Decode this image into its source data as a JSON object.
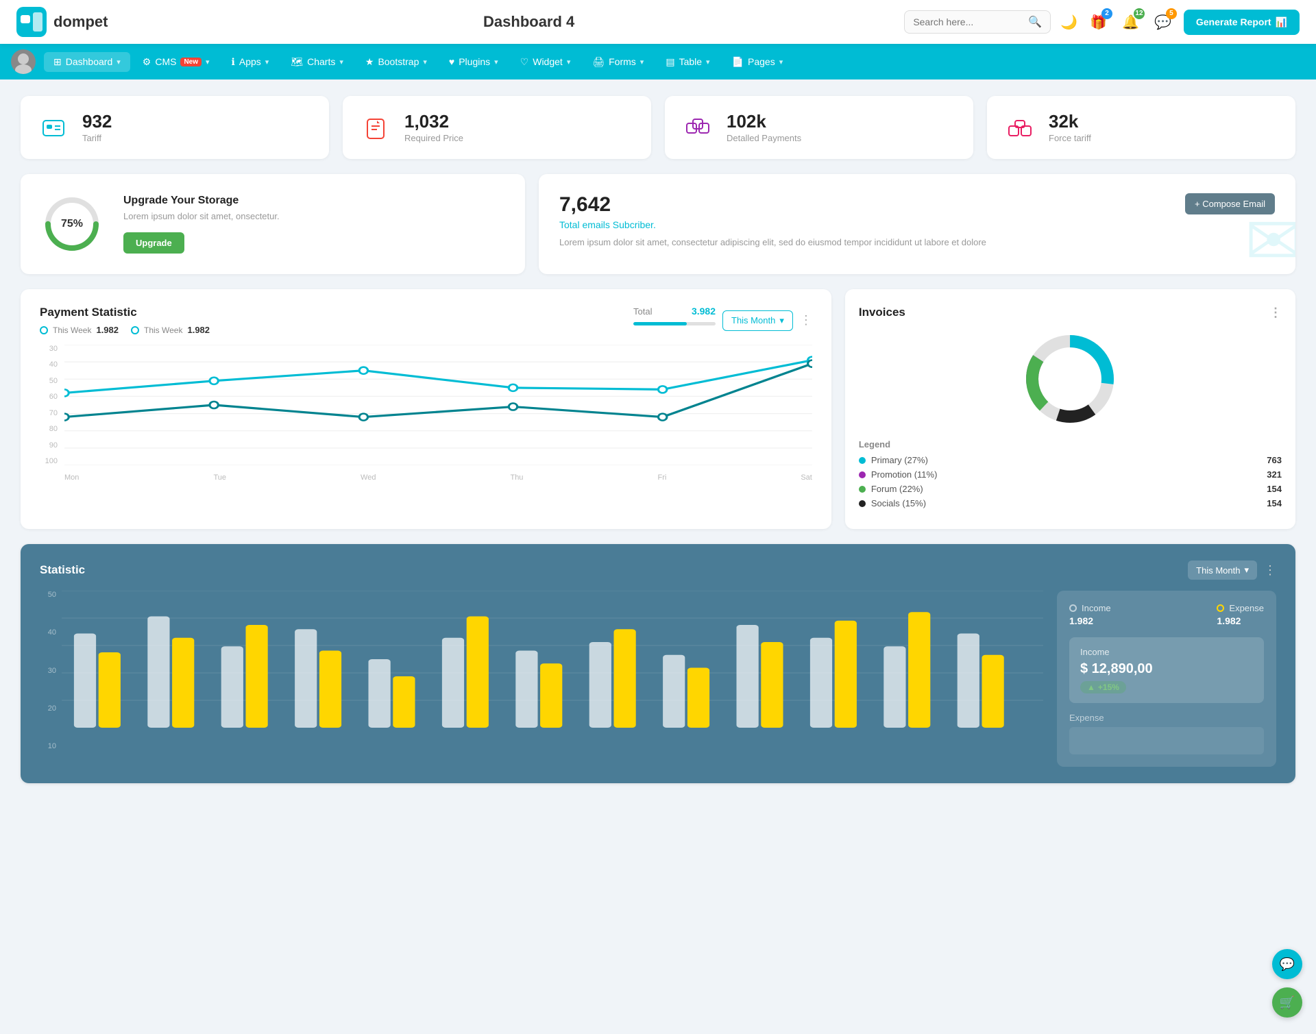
{
  "header": {
    "logo_text": "dompet",
    "page_title": "Dashboard 4",
    "search_placeholder": "Search here...",
    "generate_btn": "Generate Report",
    "badges": {
      "gift": "2",
      "bell": "12",
      "chat": "5"
    }
  },
  "navbar": {
    "items": [
      {
        "label": "Dashboard",
        "active": true,
        "has_chevron": true
      },
      {
        "label": "CMS",
        "active": false,
        "has_new": true,
        "has_chevron": true
      },
      {
        "label": "Apps",
        "active": false,
        "has_chevron": true
      },
      {
        "label": "Charts",
        "active": false,
        "has_chevron": true
      },
      {
        "label": "Bootstrap",
        "active": false,
        "has_chevron": true
      },
      {
        "label": "Plugins",
        "active": false,
        "has_chevron": true
      },
      {
        "label": "Widget",
        "active": false,
        "has_chevron": true
      },
      {
        "label": "Forms",
        "active": false,
        "has_chevron": true
      },
      {
        "label": "Table",
        "active": false,
        "has_chevron": true
      },
      {
        "label": "Pages",
        "active": false,
        "has_chevron": true
      }
    ]
  },
  "stat_cards": [
    {
      "value": "932",
      "label": "Tariff",
      "icon": "tariff"
    },
    {
      "value": "1,032",
      "label": "Required Price",
      "icon": "price"
    },
    {
      "value": "102k",
      "label": "Detalled Payments",
      "icon": "payments"
    },
    {
      "value": "32k",
      "label": "Force tariff",
      "icon": "force"
    }
  ],
  "storage": {
    "percent": "75%",
    "title": "Upgrade Your Storage",
    "desc": "Lorem ipsum dolor sit amet, onsectetur.",
    "btn": "Upgrade",
    "percent_num": 75
  },
  "email": {
    "count": "7,642",
    "subtitle": "Total emails Subcriber.",
    "desc": "Lorem ipsum dolor sit amet, consectetur adipiscing elit, sed do eiusmod tempor incididunt ut labore et dolore",
    "compose_btn": "+ Compose Email"
  },
  "payment_statistic": {
    "title": "Payment Statistic",
    "this_week_1_label": "This Week",
    "this_week_1_value": "1.982",
    "this_week_2_label": "This Week",
    "this_week_2_value": "1.982",
    "this_month_btn": "This Month",
    "total_label": "Total",
    "total_value": "3.982",
    "progress": 65,
    "y_labels": [
      "100",
      "90",
      "80",
      "70",
      "60",
      "50",
      "40",
      "30"
    ],
    "x_labels": [
      "Mon",
      "Tue",
      "Wed",
      "Thu",
      "Fri",
      "Sat"
    ],
    "line1_points": "0,60 140,70 280,80 420,65 560,63 700,90",
    "line2_points": "0,40 140,50 280,40 420,50 560,40 700,87"
  },
  "invoices": {
    "title": "Invoices",
    "legend": [
      {
        "label": "Primary (27%)",
        "color": "#00BCD4",
        "value": "763"
      },
      {
        "label": "Promotion (11%)",
        "color": "#9C27B0",
        "value": "321"
      },
      {
        "label": "Forum (22%)",
        "color": "#4CAF50",
        "value": "154"
      },
      {
        "label": "Socials (15%)",
        "color": "#333",
        "value": "154"
      }
    ],
    "donut": {
      "segments": [
        {
          "pct": 27,
          "color": "#00BCD4"
        },
        {
          "pct": 11,
          "color": "#9C27B0"
        },
        {
          "pct": 22,
          "color": "#4CAF50"
        },
        {
          "pct": 15,
          "color": "#333"
        },
        {
          "pct": 25,
          "color": "#e0e0e0"
        }
      ]
    }
  },
  "statistic": {
    "title": "Statistic",
    "this_month_btn": "This Month",
    "y_labels": [
      "50",
      "40",
      "30",
      "20",
      "10"
    ],
    "income": {
      "label": "Income",
      "value": "1.982",
      "detail_label": "Income",
      "amount": "$ 12,890,00",
      "badge": "+15%"
    },
    "expense": {
      "label": "Expense",
      "value": "1.982"
    }
  },
  "widgets": {
    "chat_icon": "💬",
    "cart_icon": "🛒"
  }
}
